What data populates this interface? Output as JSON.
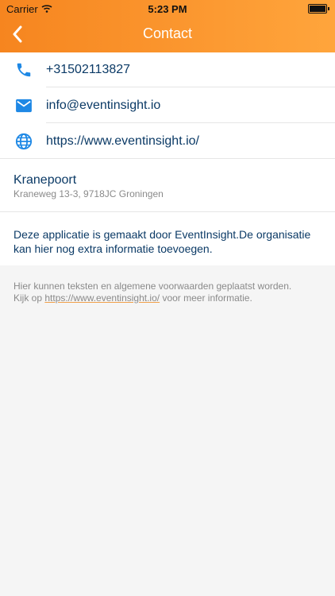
{
  "status": {
    "carrier": "Carrier",
    "time": "5:23 PM"
  },
  "nav": {
    "title": "Contact"
  },
  "contact": {
    "phone": "+31502113827",
    "email": "info@eventinsight.io",
    "website": "https://www.eventinsight.io/"
  },
  "address": {
    "name": "Kranepoort",
    "line": "Kraneweg 13-3, 9718JC Groningen"
  },
  "about": {
    "text": "Deze applicatie is gemaakt door EventInsight.De organisatie kan hier nog extra informatie toevoegen."
  },
  "legal": {
    "line1": "Hier kunnen teksten en algemene voorwaarden geplaatst worden.",
    "before_link": "Kijk op ",
    "link_text": "https://www.eventinsight.io/",
    "after_link": " voor meer informatie."
  },
  "colors": {
    "header_start": "#f6851f",
    "header_end": "#ffa53c",
    "icon_blue": "#1e88e5",
    "text_blue": "#0b3a66"
  },
  "icons": {
    "back": "chevron-left-icon",
    "phone": "phone-icon",
    "email": "mail-icon",
    "website": "globe-icon"
  }
}
